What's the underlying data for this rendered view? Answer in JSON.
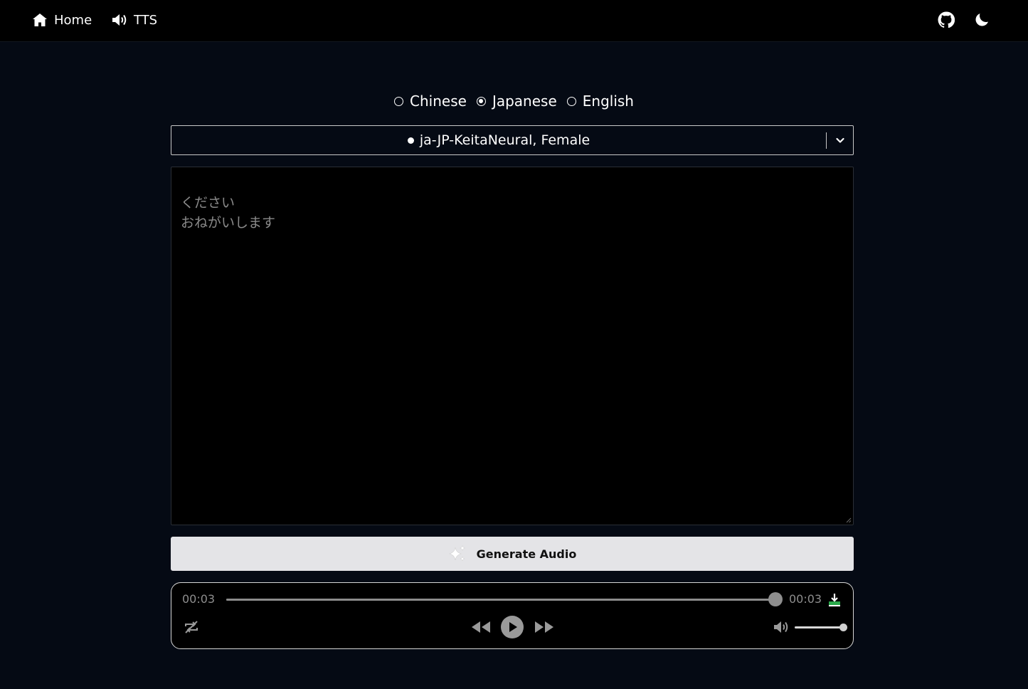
{
  "nav": {
    "home_label": "Home",
    "tts_label": "TTS",
    "github_icon": "github-icon",
    "theme_icon": "moon-icon"
  },
  "languages": {
    "options": [
      "Chinese",
      "Japanese",
      "English"
    ],
    "selected": "Japanese"
  },
  "voice_select": {
    "value": "ja-JP-KeitaNeural, Female"
  },
  "text_input": {
    "lines": [
      "ください",
      "おねがいします"
    ]
  },
  "generate_button": {
    "label": "Generate Audio",
    "icon": "sparkles-icon"
  },
  "player": {
    "current_time": "00:03",
    "duration": "00:03",
    "progress": 1.0,
    "volume": 1.0,
    "icons": [
      "download-icon",
      "repeat-off-icon",
      "rewind-icon",
      "play-icon",
      "fast-forward-icon",
      "volume-icon"
    ]
  },
  "colors": {
    "background": "#050a14",
    "topbar": "#000000",
    "button_bg": "#e4e4e7",
    "download_accent": "#2aa84a"
  }
}
